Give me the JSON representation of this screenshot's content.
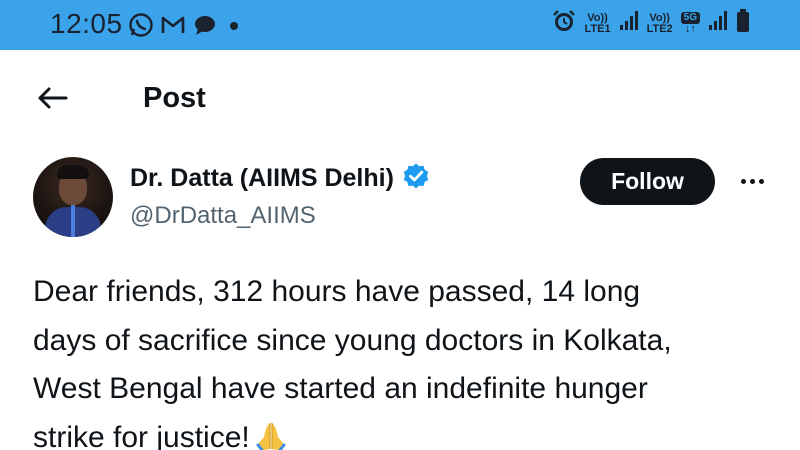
{
  "status_bar": {
    "time": "12:05",
    "left_icons": [
      "whatsapp-icon",
      "gmail-icon",
      "chat-bubble-icon",
      "notification-dot-icon"
    ],
    "sim1": {
      "top": "Vo))",
      "bottom": "LTE1"
    },
    "sim2": {
      "top": "Vo))",
      "bottom": "LTE2"
    },
    "network_badge": "5G",
    "network_arrows": "↓↑",
    "right_icons": [
      "alarm-icon",
      "signal-icon",
      "signal-icon",
      "battery-icon"
    ],
    "background_color": "#3aa3ea"
  },
  "header": {
    "back_icon": "arrow-left-icon",
    "title": "Post"
  },
  "author": {
    "name": "Dr. Datta (AIIMS Delhi)",
    "handle": "@DrDatta_AIIMS",
    "verified_icon": "verified-badge-icon",
    "verified_color": "#1d9bf0"
  },
  "actions": {
    "follow_label": "Follow",
    "more_icon": "more-options-icon"
  },
  "post": {
    "lines": [
      "Dear friends, 312 hours have passed, 14 long",
      "days of sacrifice since young doctors in Kolkata,",
      "West Bengal have started an indefinite hunger",
      "strike for justice!"
    ],
    "emoji_icon": "folded-hands-icon"
  }
}
